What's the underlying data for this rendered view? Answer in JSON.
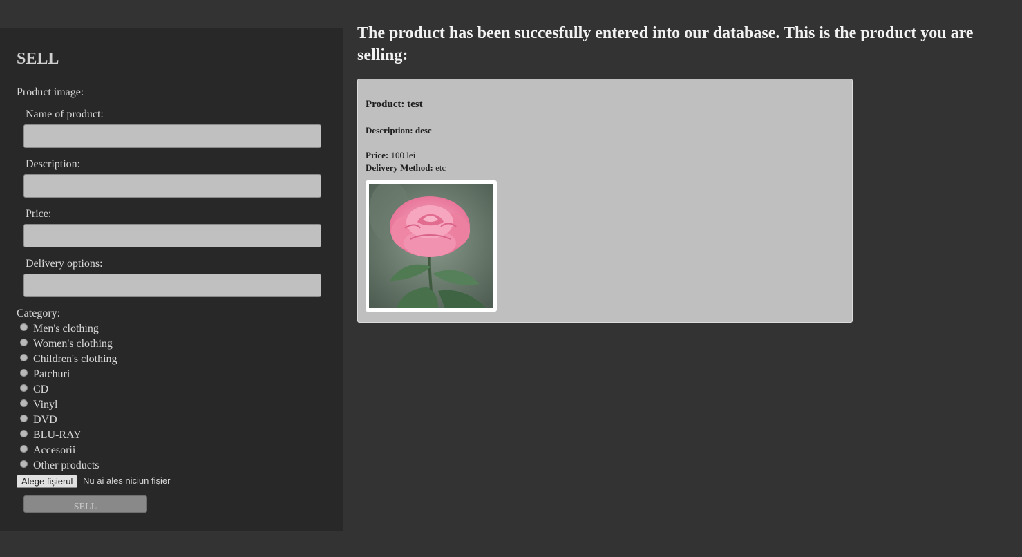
{
  "sidebar": {
    "title": "SELL",
    "product_image_label": "Product image:",
    "fields": [
      {
        "label": "Name of product:",
        "value": ""
      },
      {
        "label": "Description:",
        "value": ""
      },
      {
        "label": "Price:",
        "value": ""
      },
      {
        "label": "Delivery options:",
        "value": ""
      }
    ],
    "category_label": "Category:",
    "categories": [
      "Men's clothing",
      "Women's clothing",
      "Children's clothing",
      "Patchuri",
      "CD",
      "Vinyl",
      "DVD",
      "BLU-RAY",
      "Accesorii",
      "Other products"
    ],
    "file_button": "Alege fișierul",
    "file_status": "Nu ai ales niciun fișier",
    "submit_label": "SELL"
  },
  "result": {
    "heading": "The product has been succesfully entered into our database. This is the product you are selling:",
    "product_label": "Product:",
    "product_value": "test",
    "description_label": "Description:",
    "description_value": "desc",
    "price_label": "Price:",
    "price_value": "100 lei",
    "delivery_label": "Delivery Method:",
    "delivery_value": "etc",
    "image_icon": "pink-rose-photo"
  },
  "colors": {
    "page_bg": "#333333",
    "sidebar_bg": "#282828",
    "card_bg": "#bfbfbf",
    "field_bg": "#c0c0c0",
    "button_bg": "#898989"
  }
}
